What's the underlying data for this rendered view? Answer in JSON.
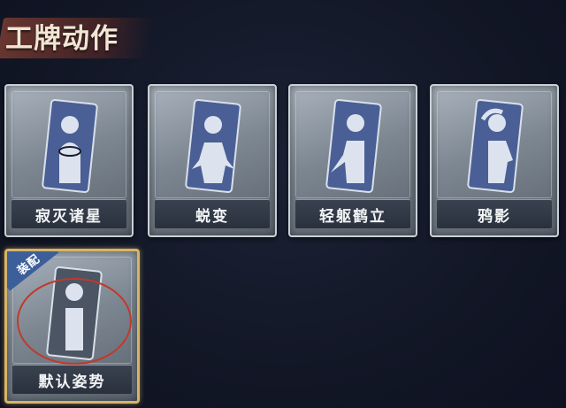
{
  "header": {
    "title": "工牌动作"
  },
  "cards": [
    {
      "label": "寂灭诸星",
      "pose": "hands-together"
    },
    {
      "label": "蜕变",
      "pose": "arms-open"
    },
    {
      "label": "轻躯鹤立",
      "pose": "arm-forward"
    },
    {
      "label": "鸦影",
      "pose": "hand-on-head"
    },
    {
      "label": "默认姿势",
      "pose": "default",
      "equipped": true,
      "badge": "装配"
    }
  ],
  "colors": {
    "accent_gold": "#d7b466",
    "badge_blue": "#3c5f9a",
    "highlight_red": "#c0392b"
  }
}
